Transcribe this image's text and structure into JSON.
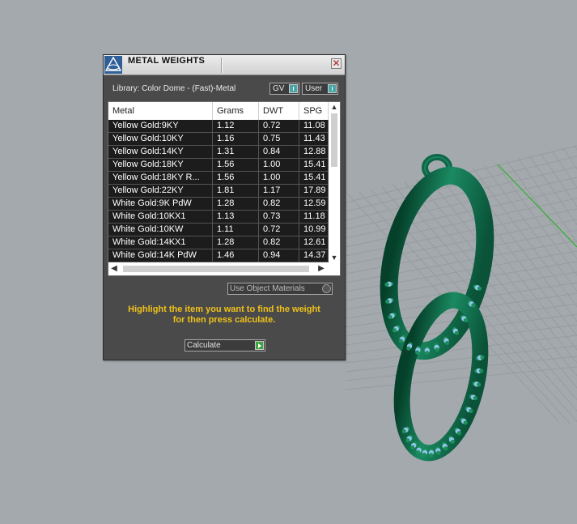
{
  "dialog": {
    "title": "METAL WEIGHTS",
    "close_glyph": "✕",
    "library_label": "Library: Color Dome - (Fast)-Metal",
    "gv_label": "GV",
    "user_label": "User",
    "use_object_materials_label": "Use Object Materials",
    "instructions_line1": "Highlight the item you want to find the weight",
    "instructions_line2": "for then press calculate.",
    "calculate_label": "Calculate"
  },
  "table": {
    "columns": [
      "Metal",
      "Grams",
      "DWT",
      "SPG"
    ],
    "rows": [
      [
        "Yellow Gold:9KY",
        "1.12",
        "0.72",
        "11.08"
      ],
      [
        "Yellow Gold:10KY",
        "1.16",
        "0.75",
        "11.43"
      ],
      [
        "Yellow Gold:14KY",
        "1.31",
        "0.84",
        "12.88"
      ],
      [
        "Yellow Gold:18KY",
        "1.56",
        "1.00",
        "15.41"
      ],
      [
        "Yellow Gold:18KY R...",
        "1.56",
        "1.00",
        "15.41"
      ],
      [
        "Yellow Gold:22KY",
        "1.81",
        "1.17",
        "17.89"
      ],
      [
        "White Gold:9K PdW",
        "1.28",
        "0.82",
        "12.59"
      ],
      [
        "White Gold:10KX1",
        "1.13",
        "0.73",
        "11.18"
      ],
      [
        "White Gold:10KW",
        "1.11",
        "0.72",
        "10.99"
      ],
      [
        "White Gold:14KX1",
        "1.28",
        "0.82",
        "12.61"
      ],
      [
        "White Gold:14K PdW",
        "1.46",
        "0.94",
        "14.37"
      ]
    ]
  },
  "icons": {
    "logo": "app-logo-icon",
    "close": "close-icon",
    "scroll_up": "chevron-up-icon",
    "scroll_down": "chevron-down-icon",
    "scroll_left": "chevron-left-icon",
    "scroll_right": "chevron-right-icon",
    "calculate": "play-icon"
  },
  "colors": {
    "viewport_bg": "#a4a9ad",
    "grid": "#979ca0",
    "axis": "#2fb02f",
    "pendant": "#0f6a4a",
    "gem": "#8ec6ea",
    "dialog_bg": "#4a4a4a",
    "instructions": "#f0c21a"
  }
}
